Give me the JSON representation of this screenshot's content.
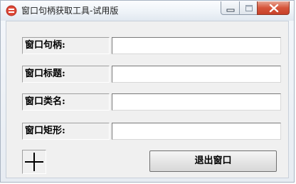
{
  "window": {
    "title": "窗口句柄获取工具-试用版",
    "app_icon": "red-round-app-icon",
    "controls": {
      "minimize_icon": "minimize-icon",
      "maximize_icon": "maximize-icon",
      "close_icon": "close-icon"
    }
  },
  "form": {
    "rows": [
      {
        "label": "窗口句柄:",
        "value": ""
      },
      {
        "label": "窗口标题:",
        "value": ""
      },
      {
        "label": "窗口类名:",
        "value": ""
      },
      {
        "label": "窗口矩形:",
        "value": ""
      }
    ]
  },
  "picker": {
    "icon": "crosshair-icon"
  },
  "buttons": {
    "exit_label": "退出窗口"
  },
  "colors": {
    "close_button": "#d6553a",
    "client_background": "#f0f0f0"
  }
}
